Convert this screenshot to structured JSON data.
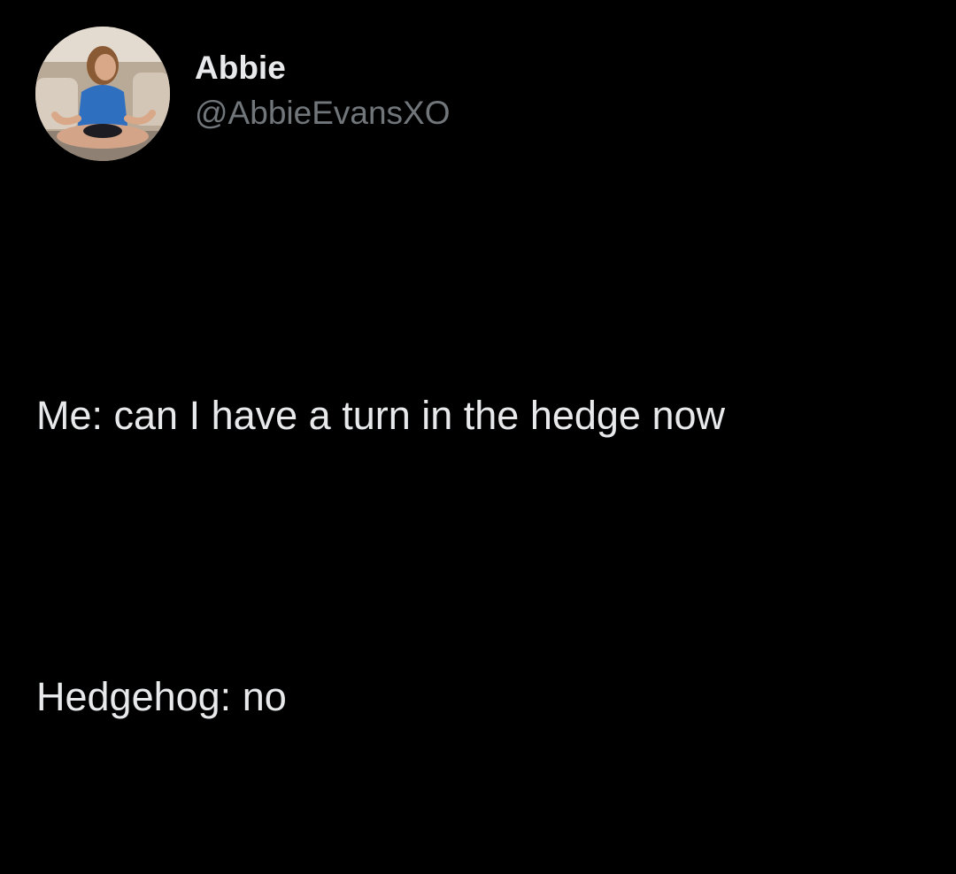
{
  "tweet": {
    "author": {
      "display_name": "Abbie",
      "handle": "@AbbieEvansXO",
      "avatar_icon": "profile-photo"
    },
    "text_lines": [
      "Me: can I have a turn in the hedge now",
      "Hedgehog: no"
    ]
  },
  "colors": {
    "background": "#000000",
    "primary_text": "#e7e9ea",
    "secondary_text": "#71767b"
  }
}
